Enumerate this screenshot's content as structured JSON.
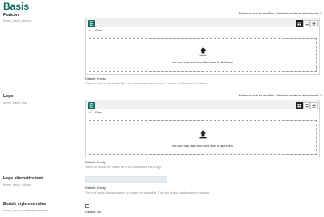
{
  "page": {
    "title": "Basis"
  },
  "favicon": {
    "label": "Favicon",
    "path": "theme_basis | favicon",
    "max_size": "Maximum size for new files: Unlimited, maximum attachments: 1",
    "files_crumb": "Files",
    "drop_text": "You can drag and drop files here to add them.",
    "default": "Default: Empty",
    "description": "Select or upload the image file to be used as the site's favicon. Use an icon that fits your theme."
  },
  "logo": {
    "label": "Logo",
    "path": "theme_basis | logo",
    "max_size": "Maximum size for new files: Unlimited, maximum attachments: 1",
    "files_crumb": "Files",
    "drop_text": "You can drag and drop files here to add them.",
    "default": "Default: Empty",
    "description": "Select or upload the image file to be used as the site's logo."
  },
  "logo_alt": {
    "label": "Logo alternative text",
    "path": "theme_basis | altlogo",
    "value": "",
    "default": "Default: Empty",
    "description": "The text that is displayed when an image isn't available. This field is also read by screen readers."
  },
  "style_overrides": {
    "label": "Enable style overrides",
    "path": "theme_basis | enablestyleoverrides",
    "checked": false,
    "default": "Default: No"
  },
  "icons": {
    "add": "file-add-icon",
    "grid_view": "grid-view-icon",
    "list_view": "list-view-icon",
    "tree_view": "tree-view-icon",
    "folder": "folder-icon",
    "upload": "upload-arrow-icon"
  },
  "colors": {
    "accent": "#0f6e63",
    "muted": "#8a9097"
  }
}
